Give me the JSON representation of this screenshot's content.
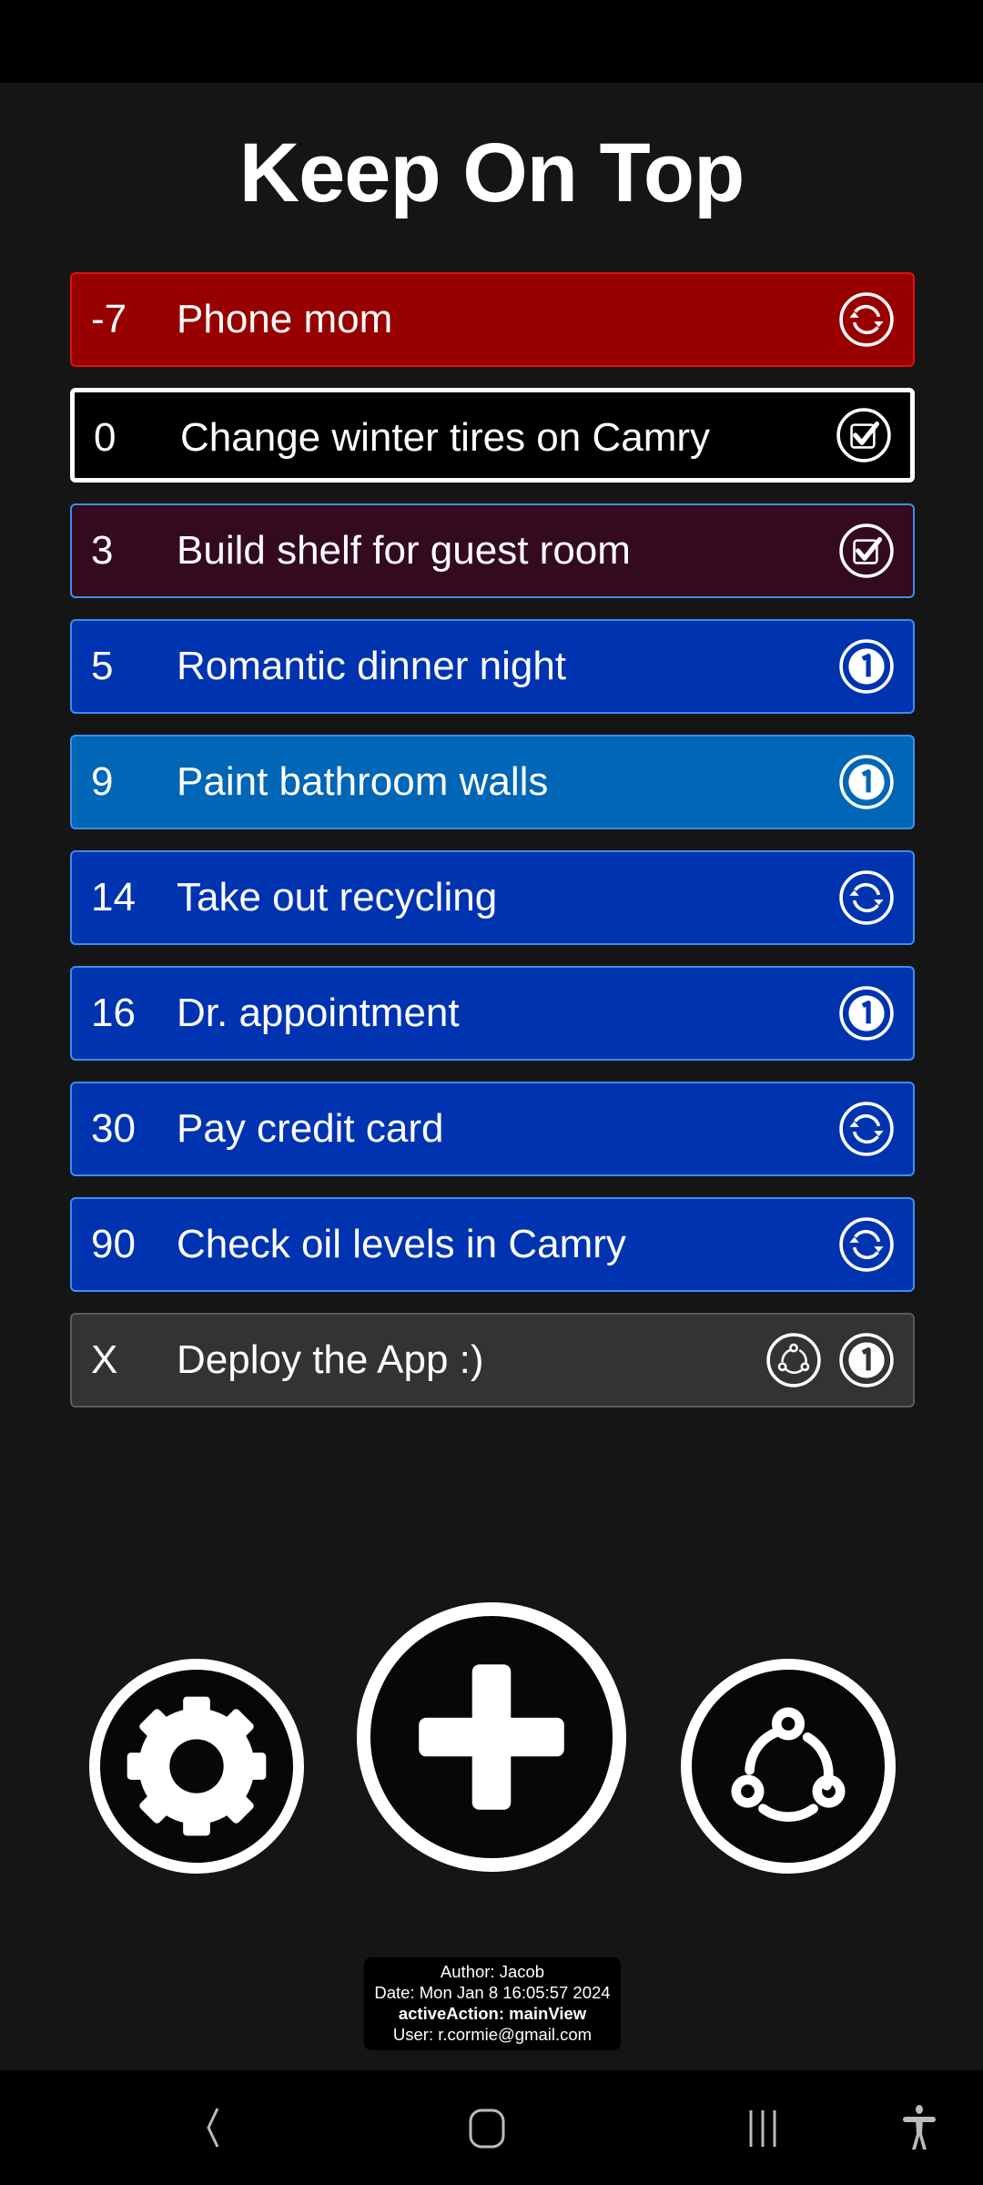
{
  "app": {
    "title": "Keep On Top"
  },
  "tasks": [
    {
      "days": "-7",
      "label": "Phone mom",
      "style": "overdue",
      "color": "#980000",
      "icons": [
        "repeat-icon"
      ]
    },
    {
      "days": "0",
      "label": "Change winter tires on Camry",
      "style": "selected",
      "color": "#000000",
      "icons": [
        "checkbox-icon"
      ]
    },
    {
      "days": "3",
      "label": "Build shelf for guest room",
      "style": "soon",
      "color": "#330a1e",
      "icons": [
        "checkbox-icon"
      ]
    },
    {
      "days": "5",
      "label": "Romantic dinner night",
      "style": "upcoming",
      "color": "#0033b0",
      "icons": [
        "one-time-icon"
      ]
    },
    {
      "days": "9",
      "label": "Paint bathroom walls",
      "style": "upcoming-alt",
      "color": "#0066b5",
      "icons": [
        "one-time-icon"
      ]
    },
    {
      "days": "14",
      "label": "Take out recycling",
      "style": "upcoming",
      "color": "#0033b0",
      "icons": [
        "repeat-icon"
      ]
    },
    {
      "days": "16",
      "label": "Dr. appointment",
      "style": "upcoming",
      "color": "#0033b0",
      "icons": [
        "one-time-icon"
      ]
    },
    {
      "days": "30",
      "label": "Pay credit card",
      "style": "upcoming",
      "color": "#0033b0",
      "icons": [
        "repeat-icon"
      ]
    },
    {
      "days": "90",
      "label": "Check oil levels in Camry",
      "style": "upcoming",
      "color": "#0033b0",
      "icons": [
        "repeat-icon"
      ]
    },
    {
      "days": "X",
      "label": "Deploy the App :)",
      "style": "unscheduled",
      "color": "#333333",
      "icons": [
        "share-icon",
        "one-time-icon"
      ]
    }
  ],
  "actions": {
    "settings": "gear-icon",
    "add": "plus-icon",
    "share": "share-icon"
  },
  "info": {
    "author": "Author: Jacob",
    "date": "Date: Mon Jan 8 16:05:57 2024",
    "active_action": "activeAction: mainView",
    "user": "User: r.cormie@gmail.com"
  },
  "navbar": {
    "back": "back-icon",
    "home": "home-icon",
    "recents": "recents-icon",
    "accessibility": "accessibility-icon"
  }
}
